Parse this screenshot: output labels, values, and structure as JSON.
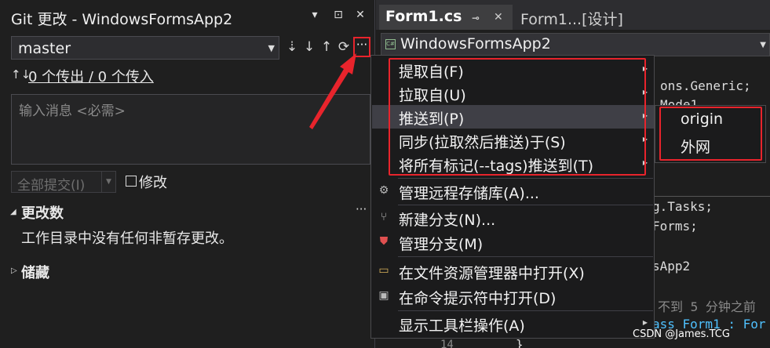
{
  "git_panel": {
    "title": "Git 更改 - WindowsFormsApp2",
    "title_controls": [
      "▾",
      "⊡",
      "✕"
    ],
    "branch": "master",
    "toolbar_icons": [
      "fetch-icon",
      "pull-icon",
      "push-icon",
      "sync-icon",
      "more-options-icon"
    ],
    "more_label": "···",
    "sync_icon": "↑↓",
    "sync_status": "0 个传出 / 0 个传入",
    "commit_placeholder": "输入消息 <必需>",
    "commit_all_label": "全部提交(I)",
    "amend_label": "修改",
    "changes_header": "更改数",
    "changes_more": "···",
    "changes_empty": "工作目录中没有任何非暂存更改。",
    "stash_header": "储藏"
  },
  "editor": {
    "tabs": [
      {
        "label": "Form1.cs"
      },
      {
        "label": "Form1...[设计]"
      }
    ],
    "project": "WindowsFormsApp2",
    "code_fragments": {
      "generic": "ons.Generic;",
      "model": "Mode1",
      "tasks": "g.Tasks;",
      "forms": "Forms;",
      "app": "sApp2",
      "comment": "不到 5 分钟之前",
      "class_decl": "ass Form1 : For",
      "brace": "}"
    },
    "line_number": "14"
  },
  "context_menu": {
    "items": [
      {
        "label": "提取自(F)",
        "icon": "",
        "submenu": true
      },
      {
        "label": "拉取自(U)",
        "icon": "",
        "submenu": true
      },
      {
        "label": "推送到(P)",
        "icon": "",
        "submenu": true,
        "selected": true
      },
      {
        "label": "同步(拉取然后推送)于(S)",
        "icon": "",
        "submenu": true
      },
      {
        "label": "将所有标记(--tags)推送到(T)",
        "icon": "",
        "submenu": true
      },
      {
        "label": "管理远程存储库(A)...",
        "icon": "gear-icon",
        "submenu": false
      },
      {
        "label": "新建分支(N)...",
        "icon": "new-branch-icon",
        "submenu": false
      },
      {
        "label": "管理分支(M)",
        "icon": "manage-branches-icon",
        "submenu": false
      },
      {
        "label": "在文件资源管理器中打开(X)",
        "icon": "folder-open-icon",
        "submenu": false
      },
      {
        "label": "在命令提示符中打开(D)",
        "icon": "terminal-icon",
        "submenu": false
      },
      {
        "label": "显示工具栏操作(A)",
        "icon": "",
        "submenu": true
      }
    ]
  },
  "submenu": {
    "items": [
      "origin",
      "外网"
    ]
  },
  "watermark": "CSDN @James.TCG",
  "colors": {
    "annotation_red": "#e8242c",
    "panel_bg": "#1f1f1f",
    "menu_bg": "#1b1b1c",
    "selected_bg": "#3f3f46"
  }
}
